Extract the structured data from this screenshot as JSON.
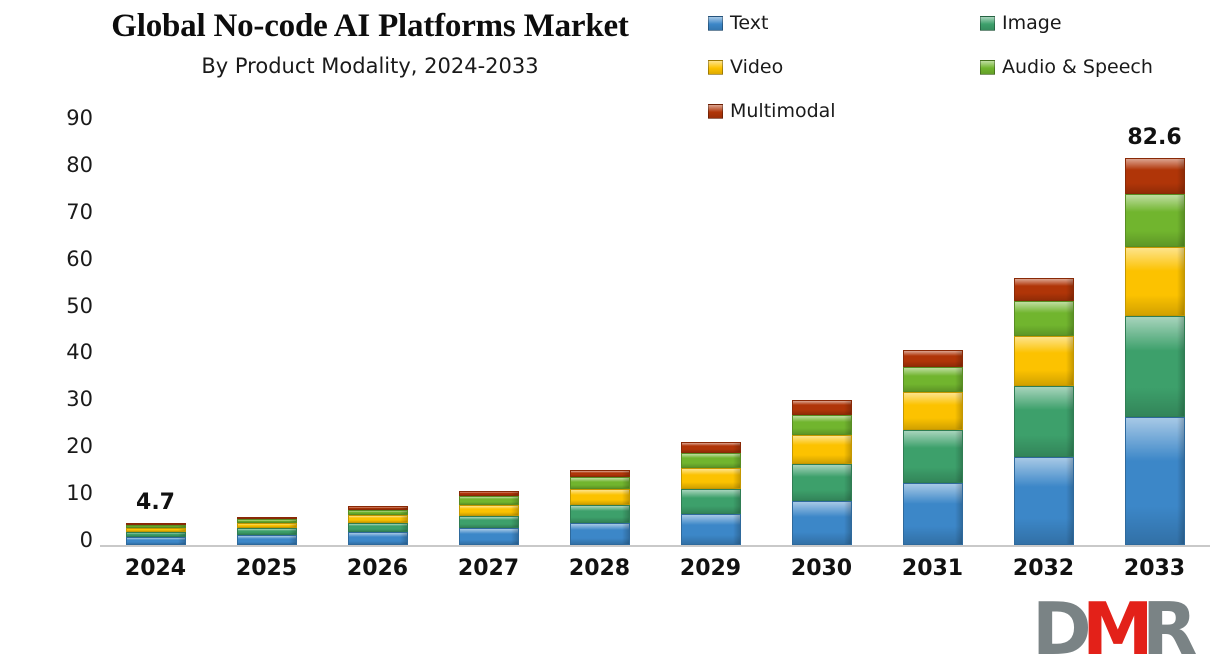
{
  "chart_data": {
    "type": "bar",
    "subtype": "stacked-column",
    "title": "Global No-code AI Platforms Market",
    "subtitle": "By Product Modality, 2024-2033",
    "xlabel": "",
    "ylabel": "",
    "ylim": [
      0,
      90
    ],
    "yticks": [
      0,
      10,
      20,
      30,
      40,
      50,
      60,
      70,
      80,
      90
    ],
    "grid": false,
    "legend_position": "top-right",
    "categories": [
      "2024",
      "2025",
      "2026",
      "2027",
      "2028",
      "2029",
      "2030",
      "2031",
      "2032",
      "2033"
    ],
    "series": [
      {
        "name": "Text",
        "color": "#3C87C8",
        "values": [
          1.7,
          2.2,
          2.8,
          3.6,
          4.8,
          6.6,
          9.3,
          13.2,
          18.8,
          27.2
        ]
      },
      {
        "name": "Image",
        "color": "#3DA06B",
        "values": [
          1.1,
          1.4,
          1.9,
          2.6,
          3.7,
          5.4,
          7.9,
          11.3,
          15.2,
          21.6
        ]
      },
      {
        "name": "Video",
        "color": "#FCC200",
        "values": [
          0.9,
          1.1,
          1.6,
          2.4,
          3.4,
          4.5,
          6.3,
          8.2,
          10.6,
          14.8
        ]
      },
      {
        "name": "Audio & Speech",
        "color": "#71B52E",
        "values": [
          0.6,
          0.8,
          1.2,
          1.8,
          2.5,
          3.2,
          4.3,
          5.3,
          7.5,
          11.2
        ]
      },
      {
        "name": "Multimodal",
        "color": "#B03508",
        "values": [
          0.4,
          0.5,
          0.8,
          1.2,
          1.7,
          2.3,
          3.1,
          3.6,
          4.9,
          7.8
        ]
      }
    ],
    "totals": [
      4.7,
      6.0,
      8.3,
      11.6,
      16.1,
      22.0,
      30.9,
      41.6,
      57.0,
      82.6
    ],
    "annotations": [
      {
        "category": "2024",
        "text": "4.7"
      },
      {
        "category": "2033",
        "text": "82.6"
      }
    ]
  },
  "logo": {
    "letters": [
      {
        "char": "D",
        "color": "#7A8385"
      },
      {
        "char": "M",
        "color": "#E32119"
      },
      {
        "char": "R",
        "color": "#7A8385"
      }
    ],
    "alt": "DMR"
  }
}
